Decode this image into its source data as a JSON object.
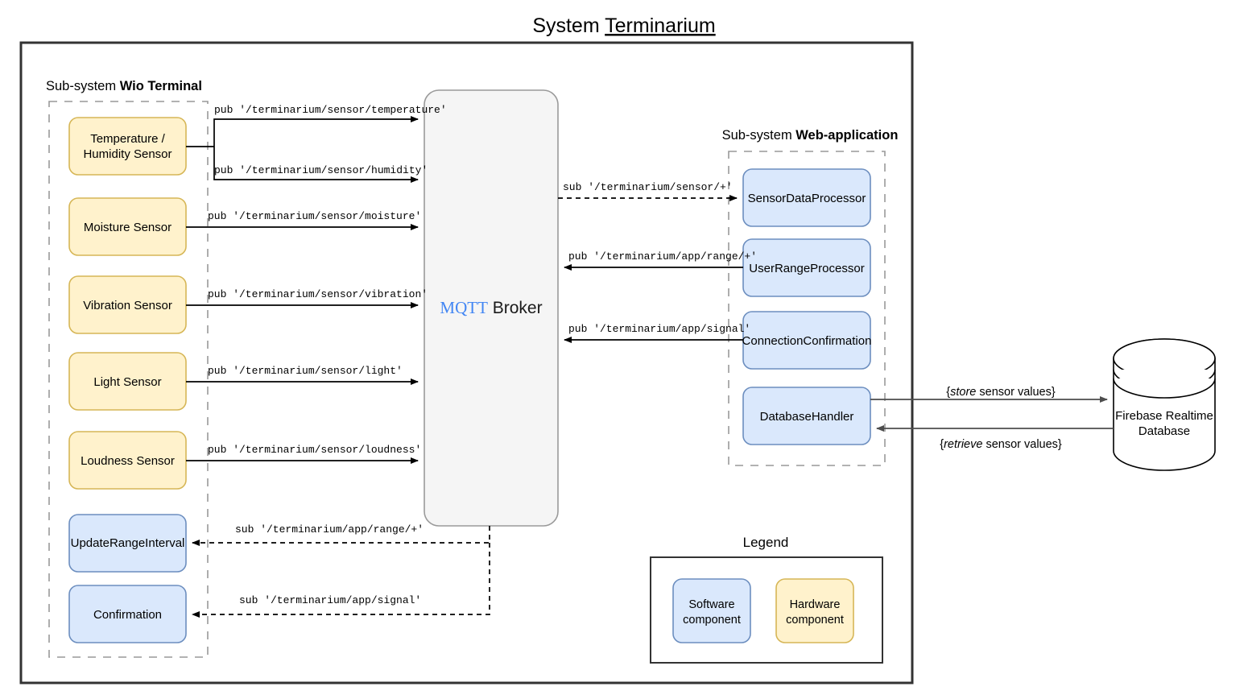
{
  "title": {
    "prefix": "System ",
    "underlined": "Terminarium"
  },
  "subsystems": {
    "wio": {
      "prefix": "Sub-system ",
      "name": "Wio Terminal"
    },
    "web": {
      "prefix": "Sub-system ",
      "name": "Web-application"
    }
  },
  "broker": {
    "brand": "MQTT",
    "label": " Broker",
    "brand_color": "#4286f4"
  },
  "hardware_nodes": [
    {
      "id": "temp-humidity-sensor",
      "label_line1": "Temperature /",
      "label_line2": "Humidity Sensor"
    },
    {
      "id": "moisture-sensor",
      "label_line1": "Moisture Sensor",
      "label_line2": ""
    },
    {
      "id": "vibration-sensor",
      "label_line1": "Vibration Sensor",
      "label_line2": ""
    },
    {
      "id": "light-sensor",
      "label_line1": "Light Sensor",
      "label_line2": ""
    },
    {
      "id": "loudness-sensor",
      "label_line1": "Loudness Sensor",
      "label_line2": ""
    }
  ],
  "wio_software_nodes": [
    {
      "id": "update-range-interval",
      "label": "UpdateRangeInterval"
    },
    {
      "id": "confirmation",
      "label": "Confirmation"
    }
  ],
  "web_software_nodes": [
    {
      "id": "sensor-data-processor",
      "label": "SensorDataProcessor"
    },
    {
      "id": "user-range-processor",
      "label": "UserRangeProcessor"
    },
    {
      "id": "connection-confirmation",
      "label": "ConnectionConfirmation"
    },
    {
      "id": "database-handler",
      "label": "DatabaseHandler"
    }
  ],
  "database": {
    "id": "firebase-realtime-database",
    "label_line1": "Firebase Realtime",
    "label_line2": "Database"
  },
  "edge_labels": {
    "pub_temperature": "pub '/terminarium/sensor/temperature'",
    "pub_humidity": "pub '/terminarium/sensor/humidity'",
    "pub_moisture": "pub '/terminarium/sensor/moisture'",
    "pub_vibration": "pub '/terminarium/sensor/vibration'",
    "pub_light": "pub '/terminarium/sensor/light'",
    "pub_loudness": "pub '/terminarium/sensor/loudness'",
    "sub_sensor_all": "sub '/terminarium/sensor/+'",
    "pub_app_range": "pub '/terminarium/app/range/+'",
    "pub_app_signal": "pub '/terminarium/app/signal'",
    "sub_app_range": "sub '/terminarium/app/range/+'",
    "sub_app_signal": "sub '/terminarium/app/signal'"
  },
  "database_edges": {
    "store_pre": "{",
    "store_em": "store",
    "store_post": " sensor values}",
    "retrieve_pre": "{",
    "retrieve_em": "retrieve",
    "retrieve_post": " sensor values}"
  },
  "legend": {
    "title": "Legend",
    "items": [
      {
        "id": "legend-software",
        "line1": "Software",
        "line2": "component",
        "fill": "#dae8fc",
        "stroke": "#6c8ebf"
      },
      {
        "id": "legend-hardware",
        "line1": "Hardware",
        "line2": "component",
        "fill": "#fff2cc",
        "stroke": "#d6b656"
      }
    ]
  }
}
